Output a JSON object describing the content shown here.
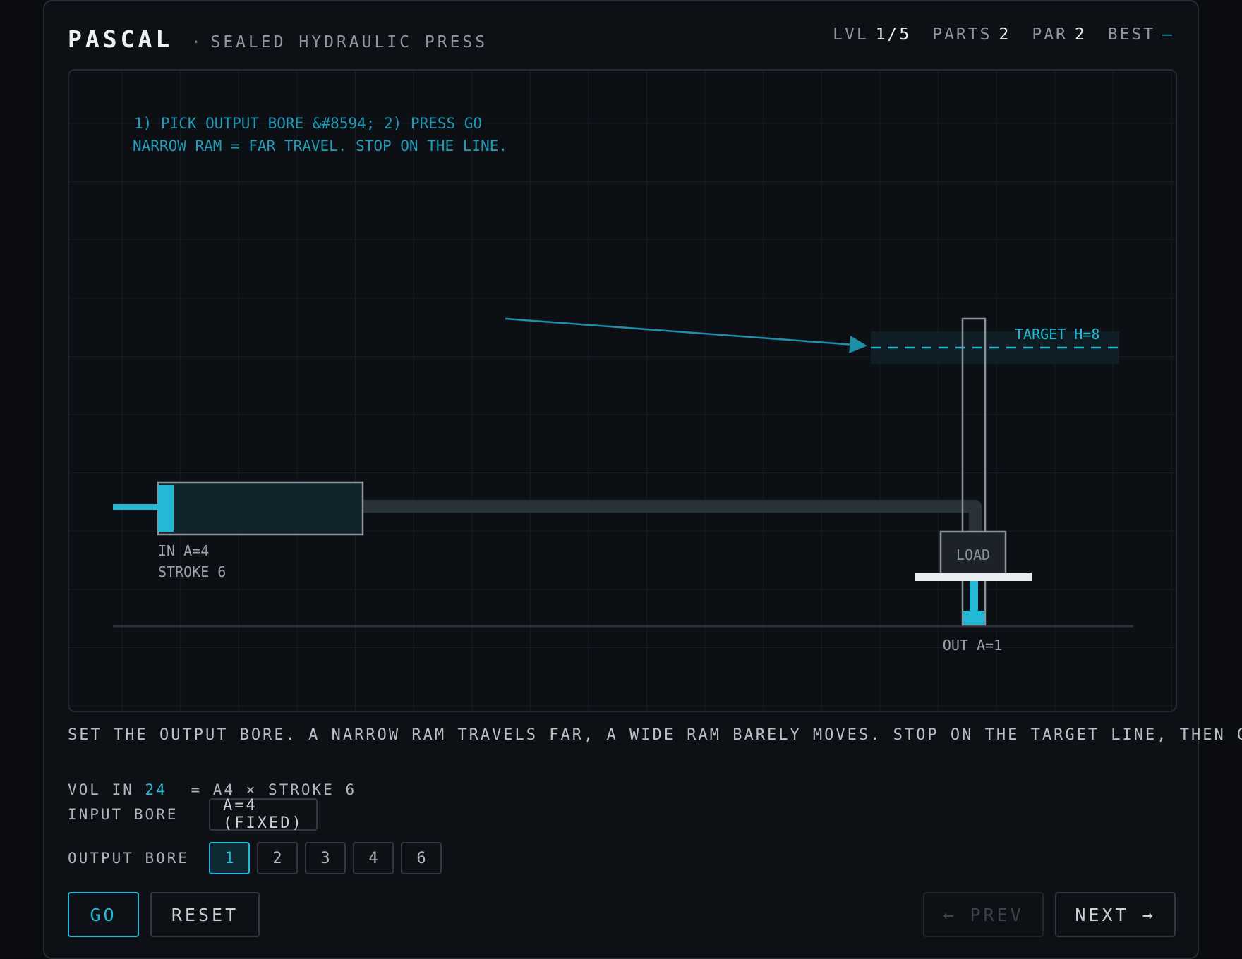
{
  "header": {
    "title": "PASCAL",
    "separator": "·",
    "subtitle": "SEALED HYDRAULIC PRESS",
    "stats": {
      "level_label": "LVL",
      "level_value": "1/5",
      "parts_label": "PARTS",
      "parts_value": "2",
      "par_label": "PAR",
      "par_value": "2",
      "best_label": "BEST",
      "best_value": "–"
    }
  },
  "stage": {
    "instruction_line1": "1) PICK OUTPUT BORE  &#8594;  2) PRESS GO",
    "instruction_line2": "NARROW RAM = FAR TRAVEL. STOP ON THE LINE.",
    "input_label": "IN  A=4",
    "stroke_label": "STROKE 6",
    "load_label": "LOAD",
    "output_label": "OUT A=1",
    "target_label": "TARGET  H=8"
  },
  "description": "SET THE OUTPUT BORE. A NARROW RAM TRAVELS FAR, A WIDE RAM BARELY MOVES. STOP ON THE TARGET LINE, THEN GO.",
  "controls": {
    "vol_label": "VOL IN",
    "vol_value": "24",
    "vol_formula": "=  A4 × STROKE 6",
    "input_bore_label": "INPUT BORE",
    "input_bore_value": "A=4 (FIXED)",
    "output_bore_label": "OUTPUT BORE",
    "output_bore_options": [
      "1",
      "2",
      "3",
      "4",
      "6"
    ],
    "output_bore_selected": "1"
  },
  "buttons": {
    "go": "GO",
    "reset": "RESET",
    "prev": "← PREV",
    "next": "NEXT →"
  },
  "colors": {
    "accent": "#22b8d6",
    "background": "#0d1014",
    "grid": "#1c2229"
  }
}
